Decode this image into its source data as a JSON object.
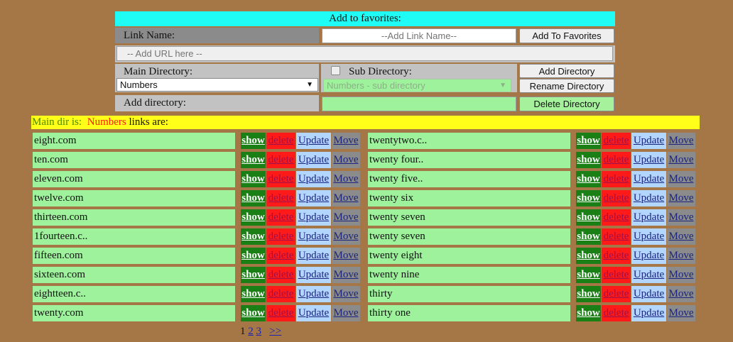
{
  "form": {
    "title": "Add to favorites:",
    "link_name_label": "Link Name:",
    "link_name_placeholder": "--Add Link Name--",
    "add_to_favorites_button": "Add To Favorites",
    "url_placeholder": "-- Add URL here --",
    "main_directory_label": "Main Directory:",
    "main_directory_value": "Numbers",
    "sub_directory_label": "Sub Directory:",
    "sub_directory_value": "Numbers - sub directory",
    "add_directory_button": "Add Directory",
    "rename_directory_button": "Rename Directory",
    "add_directory_label": "Add directory:",
    "delete_directory_button": "Delete Directory"
  },
  "main_bar": {
    "prefix": "Main dir is:",
    "dir_name": "Numbers",
    "suffix": "links are:"
  },
  "actions": {
    "show": "show",
    "delete": "delete",
    "update": "Update",
    "move": "Move"
  },
  "links_left": [
    "eight.com",
    "ten.com",
    "eleven.com",
    "twelve.com",
    "thirteen.com",
    "1fourteen.c..",
    "fifteen.com",
    "sixteen.com",
    "eightteen.c..",
    "twenty.com"
  ],
  "links_right": [
    "twentytwo.c..",
    "twenty four..",
    "twenty five..",
    "twenty six",
    "twenty seven",
    "twenty seven",
    "twenty eight",
    "twenty nine",
    "thirty",
    "thirty one"
  ],
  "pagination": {
    "current": "1",
    "pages": [
      "2",
      "3"
    ],
    "next": ">>"
  },
  "colors": {
    "background": "#a57646",
    "title_bar": "#1ffcf5",
    "main_bar": "#ffff1a",
    "link_row": "#9ef29c",
    "show": "#1a7f15",
    "delete": "#ff1a1a",
    "update": "#b3d6ff",
    "move": "#8b8b8b"
  }
}
